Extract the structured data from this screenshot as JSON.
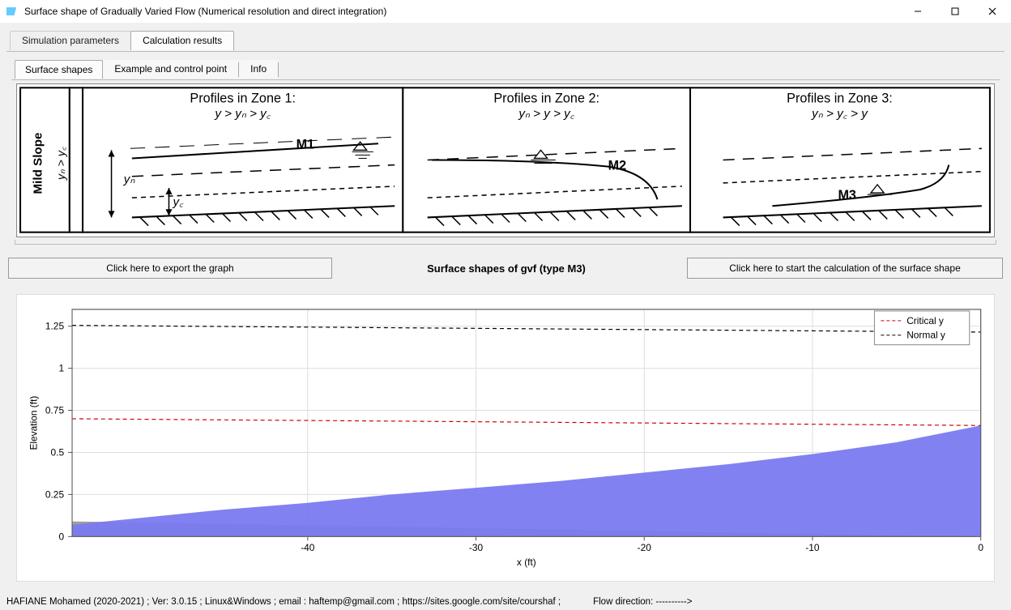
{
  "window": {
    "title": "Surface shape of Gradually Varied Flow (Numerical resolution and direct integration)"
  },
  "tabs_main": {
    "active": "Calculation results",
    "items": [
      "Simulation parameters",
      "Calculation results"
    ]
  },
  "tabs_sub": {
    "active": "Surface shapes",
    "items": [
      "Surface shapes",
      "Example and control point",
      "Info"
    ]
  },
  "diagrams": {
    "slope_label": "Mild Slope",
    "slope_cond": "yₙ > y꜀",
    "zone1": {
      "title": "Profiles in Zone 1:",
      "cond": "y > yₙ > y꜀",
      "profile": "M1",
      "yn": "yₙ",
      "yc": "y꜀"
    },
    "zone2": {
      "title": "Profiles in Zone 2:",
      "cond": "yₙ > y > y꜀",
      "profile": "M2"
    },
    "zone3": {
      "title": "Profiles in Zone 3:",
      "cond": "yₙ > y꜀ > y",
      "profile": "M3"
    }
  },
  "buttons": {
    "export": "Click here to export the graph",
    "calc": "Click here to start the calculation of the surface shape"
  },
  "center_title": "Surface shapes of gvf (type M3)",
  "chart": {
    "ylabel": "Elevation (ft)",
    "xlabel": "x (ft)",
    "legend": {
      "critical": "Critical y",
      "normal": "Normal y"
    }
  },
  "status": {
    "author": "HAFIANE Mohamed (2020-2021) ; Ver: 3.0.15 ; Linux&Windows ; email : haftemp@gmail.com ; https://sites.google.com/site/courshaf     ;",
    "flow": "Flow direction: ---------->"
  },
  "chart_data": {
    "type": "area+line",
    "xlabel": "x (ft)",
    "ylabel": "Elevation (ft)",
    "xlim": [
      -54,
      0
    ],
    "ylim": [
      0,
      1.35
    ],
    "xticks": [
      -40,
      -30,
      -20,
      -10,
      0
    ],
    "yticks": [
      0,
      0.25,
      0.5,
      0.75,
      1,
      1.25
    ],
    "series": [
      {
        "name": "Bed",
        "type": "area",
        "color": "#9a9a9a",
        "x": [
          -54,
          0
        ],
        "y": [
          0.09,
          0.0
        ]
      },
      {
        "name": "Water surface",
        "type": "area",
        "color": "#7a7af0",
        "x": [
          -54,
          -50,
          -45,
          -40,
          -35,
          -30,
          -25,
          -20,
          -15,
          -10,
          -5,
          0
        ],
        "y": [
          0.07,
          0.11,
          0.16,
          0.2,
          0.25,
          0.29,
          0.33,
          0.38,
          0.43,
          0.49,
          0.56,
          0.66
        ]
      },
      {
        "name": "Critical y",
        "type": "line",
        "style": "dashed",
        "color": "#d00000",
        "x": [
          -54,
          0
        ],
        "y": [
          0.7,
          0.66
        ]
      },
      {
        "name": "Normal y",
        "type": "line",
        "style": "dashed",
        "color": "#000000",
        "x": [
          -54,
          0
        ],
        "y": [
          1.255,
          1.215
        ]
      }
    ],
    "legend": [
      "Critical y",
      "Normal y"
    ]
  }
}
